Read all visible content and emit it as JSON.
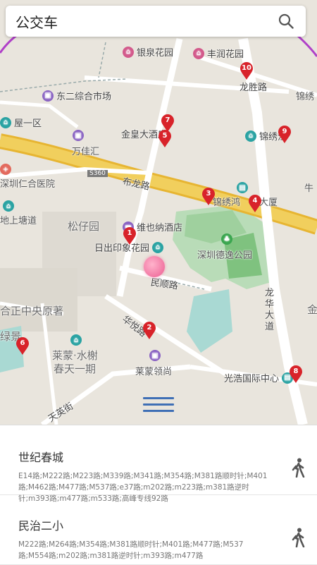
{
  "header": {
    "title": "公交车"
  },
  "map": {
    "areas": [
      "银泉花园",
      "丰润花园",
      "龙胜路",
      "锦绣",
      "东二综合市场",
      "屋一区",
      "金皇大酒店",
      "锦绣江",
      "万佳汇",
      "深圳仁合医院",
      "布龙路",
      "S360",
      "牛",
      "地上塘道",
      "锦绣鸿",
      "大厦",
      "松仔园",
      "维也纳酒店",
      "日出印象花园",
      "深圳德逸公园",
      "民顺路",
      "合正中央原著",
      "龙华大道",
      "金",
      "华悦路",
      "绿景",
      "莱蒙·水榭",
      "春天一期",
      "莱蒙领尚",
      "光浩国际中心",
      "天英街"
    ],
    "pins": [
      "1",
      "2",
      "3",
      "4",
      "5",
      "6",
      "7",
      "8",
      "9",
      "10"
    ]
  },
  "stops": [
    {
      "name": "世纪春城",
      "routes": "E14路;M222路;M223路;M339路;M341路;M354路;M381路顺时针;M401路;M462路;M477路;M537路;e37路;m202路;m223路;m381路逆时针;m393路;m477路;m533路;高峰专线92路"
    },
    {
      "name": "民治二小",
      "routes": "M222路;M264路;M354路;M381路顺时针;M401路;M477路;M537路;M554路;m202路;m381路逆时针;m393路;m477路"
    }
  ]
}
